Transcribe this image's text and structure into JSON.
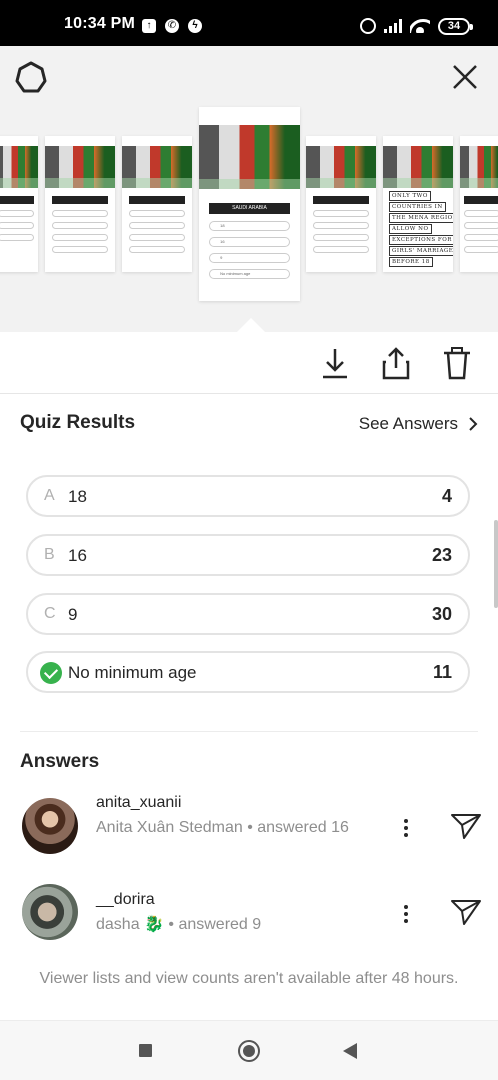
{
  "status_bar": {
    "time": "10:34 PM",
    "notification_icons": [
      "upload-icon",
      "whatsapp-icon",
      "messenger-icon"
    ],
    "battery": "34"
  },
  "story_strip": {
    "current_slide": {
      "question": "SAUDI ARABIA",
      "options": [
        "18",
        "16",
        "9",
        "No minimum age"
      ]
    },
    "fact_slide_lines": [
      "ONLY TWO",
      "COUNTRIES IN",
      "THE MENA REGION",
      "ALLOW NO",
      "EXCEPTIONS FOR",
      "GIRLS' MARRIAGE",
      "BEFORE 18"
    ]
  },
  "quiz": {
    "title": "Quiz Results",
    "see_answers": "See Answers",
    "options": [
      {
        "letter": "A",
        "text": "18",
        "count": "4",
        "correct": false
      },
      {
        "letter": "B",
        "text": "16",
        "count": "23",
        "correct": false
      },
      {
        "letter": "C",
        "text": "9",
        "count": "30",
        "correct": false
      },
      {
        "letter": "",
        "text": "No minimum age",
        "count": "11",
        "correct": true
      }
    ],
    "correct_color": "#37b24d"
  },
  "answers": {
    "title": "Answers",
    "items": [
      {
        "username": "anita_xuanii",
        "detail": "Anita Xuân Stedman • answered 16"
      },
      {
        "username": "__dorira",
        "detail": "dasha 🐉 • answered 9"
      }
    ]
  },
  "footer_note": "Viewer lists and view counts aren't available after 48 hours."
}
